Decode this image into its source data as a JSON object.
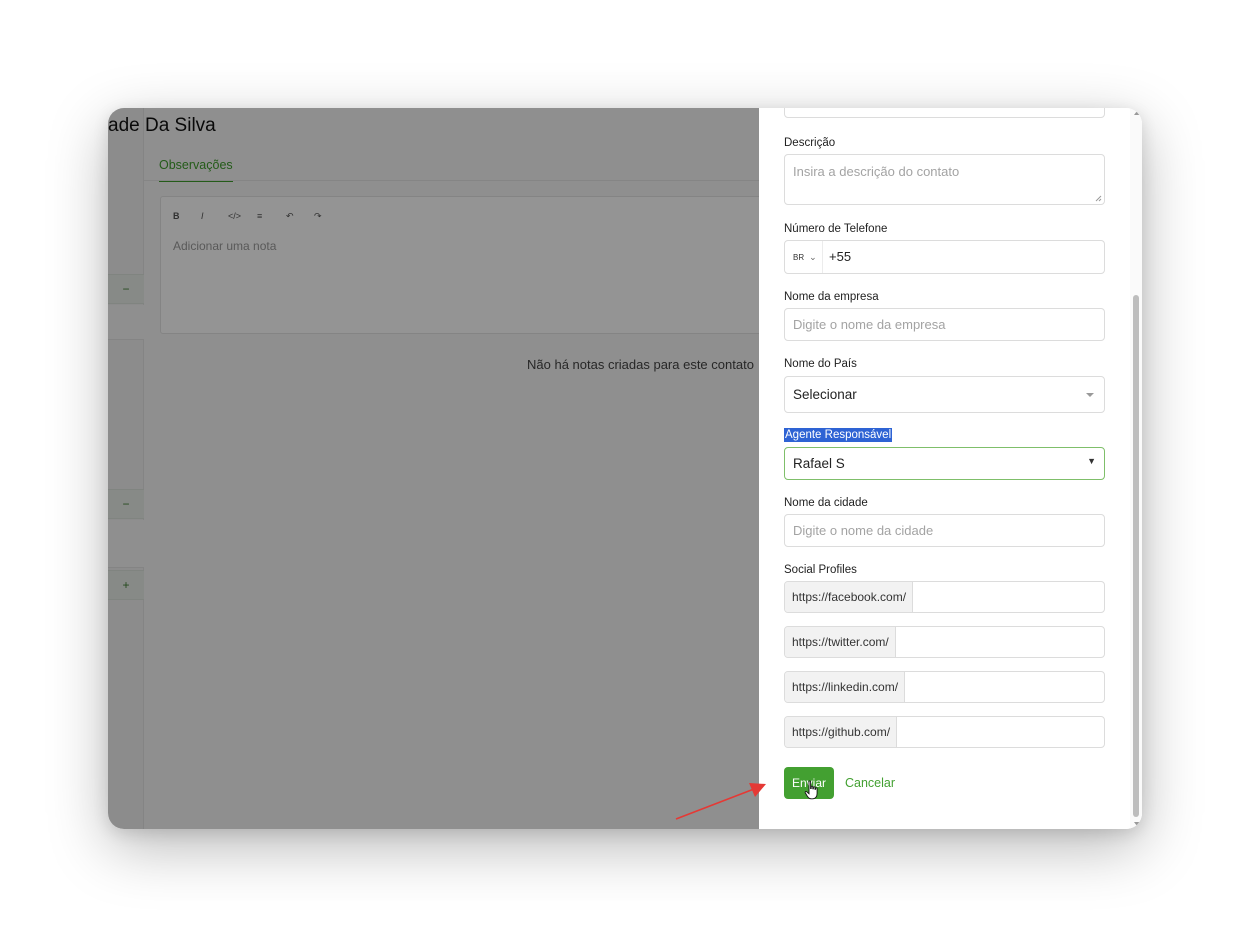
{
  "background": {
    "page_title": "ade Da Silva",
    "tab_label": "Observações",
    "editor_toolbar": [
      "B",
      "I",
      "</>",
      "≡",
      "↶",
      "↷"
    ],
    "editor_placeholder": "Adicionar uma nota",
    "empty_notes_message": "Não há notas criadas para este contato",
    "side_buttons": [
      "−",
      "−",
      "+"
    ]
  },
  "panel": {
    "description": {
      "label": "Descrição",
      "placeholder": "Insira a descrição do contato"
    },
    "phone": {
      "label": "Número de Telefone",
      "country_code": "BR",
      "value": "+55"
    },
    "company": {
      "label": "Nome da empresa",
      "placeholder": "Digite o nome da empresa"
    },
    "country": {
      "label": "Nome do País",
      "selected": "Selecionar"
    },
    "agent": {
      "label": "Agente Responsável",
      "selected": "Rafael S"
    },
    "city": {
      "label": "Nome da cidade",
      "placeholder": "Digite o nome da cidade"
    },
    "social": {
      "label": "Social Profiles",
      "profiles": [
        {
          "prefix": "https://facebook.com/"
        },
        {
          "prefix": "https://twitter.com/"
        },
        {
          "prefix": "https://linkedin.com/"
        },
        {
          "prefix": "https://github.com/"
        }
      ]
    },
    "actions": {
      "submit_label": "Enviar",
      "cancel_label": "Cancelar"
    }
  },
  "colors": {
    "accent_green": "#43a031",
    "selection_blue": "#2e63d4",
    "annotation_arrow": "#e53935"
  }
}
